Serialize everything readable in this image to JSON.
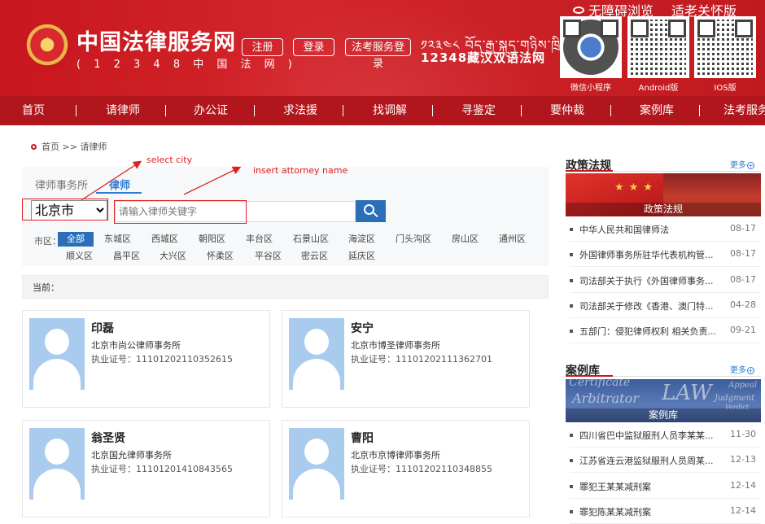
{
  "header": {
    "site_title": "中国法律服务网",
    "site_subtitle": "( 1 2 3 4 8 中 国 法 网 )",
    "buttons": {
      "register": "注册",
      "login": "登录",
      "exam_login": "法考服务登录"
    },
    "tibetan_text": "༡༢༣༤༨ བོད་རྒྱ་སྐད་གཉིས་ཁྲིམས་ཡིག",
    "bilingual_title": "12348藏汉双语法网",
    "accessibility": "无障碍浏览",
    "elderly_mode": "适老关怀版",
    "qr_codes": [
      {
        "label": "微信小程序",
        "icon": "mini-program-qr-icon"
      },
      {
        "label": "Android版",
        "icon": "android-qr-icon"
      },
      {
        "label": "IOS版",
        "icon": "ios-qr-icon"
      }
    ]
  },
  "nav": {
    "items": [
      "首页",
      "请律师",
      "办公证",
      "求法援",
      "找调解",
      "寻鉴定",
      "要仲裁",
      "案例库",
      "法考服务"
    ]
  },
  "breadcrumb": "首页 >> 请律师",
  "search": {
    "tabs": [
      "律师事务所",
      "律师"
    ],
    "active_tab": "律师",
    "city": "北京市",
    "placeholder": "请输入律师关键字",
    "search_icon": "search-icon"
  },
  "districts": {
    "label": "市区：",
    "items": [
      "全部",
      "东城区",
      "西城区",
      "朝阳区",
      "丰台区",
      "石景山区",
      "海淀区",
      "门头沟区",
      "房山区",
      "通州区",
      "顺义区",
      "昌平区",
      "大兴区",
      "怀柔区",
      "平谷区",
      "密云区",
      "延庆区"
    ],
    "active": "全部"
  },
  "current_label": "当前：",
  "annotations": {
    "select_city": "select city",
    "insert_name": "insert attorney name"
  },
  "lawyers": [
    {
      "name": "印磊",
      "firm": "北京市尚公律师事务所",
      "license": "执业证号：11101202110352615"
    },
    {
      "name": "安宁",
      "firm": "北京市博圣律师事务所",
      "license": "执业证号：11101202111362701"
    },
    {
      "name": "翁圣贤",
      "firm": "北京国允律师事务所",
      "license": "执业证号：11101201410843565"
    },
    {
      "name": "曹阳",
      "firm": "北京市京博律师事务所",
      "license": "执业证号：11101202110348855"
    }
  ],
  "sidebar": {
    "policy": {
      "title": "政策法规",
      "more": "更多",
      "banner_caption": "政策法规",
      "items": [
        {
          "title": "中华人民共和国律师法",
          "date": "08-17"
        },
        {
          "title": "外国律师事务所驻华代表机构管...",
          "date": "08-17"
        },
        {
          "title": "司法部关于执行《外国律师事务...",
          "date": "08-17"
        },
        {
          "title": "司法部关于修改《香港、澳门特...",
          "date": "04-28"
        },
        {
          "title": "五部门：侵犯律师权利 相关负责...",
          "date": "09-21"
        }
      ]
    },
    "cases": {
      "title": "案例库",
      "more": "更多",
      "banner_caption": "案例库",
      "banner_words": [
        "Certificate",
        "Arbitrator",
        "LAW",
        "Appeal",
        "Judgment",
        "Verdict"
      ],
      "items": [
        {
          "title": "四川省巴中监狱服刑人员李某某...",
          "date": "11-30"
        },
        {
          "title": "江苏省连云港监狱服刑人员周某...",
          "date": "12-13"
        },
        {
          "title": "罪犯王某某减刑案",
          "date": "12-14"
        },
        {
          "title": "罪犯陈某某减刑案",
          "date": "12-14"
        }
      ]
    }
  }
}
